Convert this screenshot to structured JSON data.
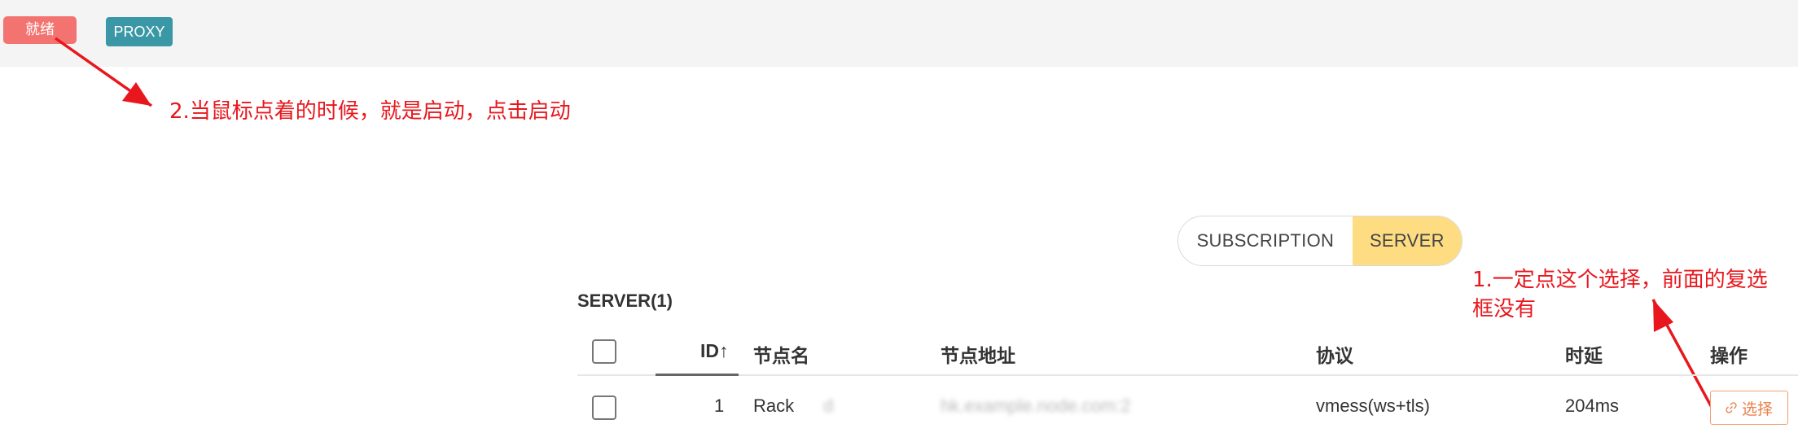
{
  "header": {
    "status_label": "就绪",
    "proxy_label": "PROXY"
  },
  "annotations": {
    "note_2": "2.当鼠标点着的时候，就是启动，点击启动",
    "note_1": "1.一定点这个选择，前面的复选框没有"
  },
  "mode_toggle": {
    "subscription": "SUBSCRIPTION",
    "server": "SERVER",
    "active": "SERVER"
  },
  "section": {
    "title": "SERVER(1)"
  },
  "table": {
    "columns": {
      "id": "ID",
      "sort_icon": "↑",
      "name": "节点名",
      "address": "节点地址",
      "protocol": "协议",
      "latency": "时延",
      "actions": "操作"
    },
    "rows": [
      {
        "id": "1",
        "name": "Rack",
        "name_tail": "d",
        "address": "hk.example.node.com:2",
        "protocol": "vmess(ws+tls)",
        "latency": "204ms",
        "action_label": "选择",
        "action_icon": "link-icon"
      }
    ]
  },
  "colors": {
    "status_tag": "#f37370",
    "proxy_tag": "#3a97a6",
    "toggle_active": "#fddc82",
    "annotation": "#e8171e",
    "select_button": "#e8814a"
  }
}
